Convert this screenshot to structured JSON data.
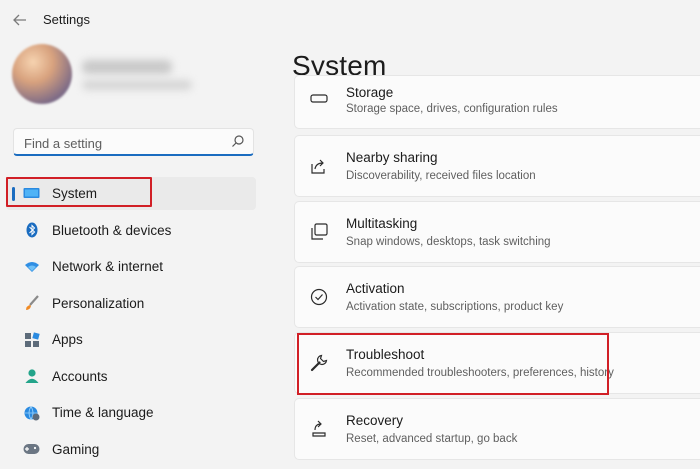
{
  "app": {
    "title": "Settings",
    "back_icon": "back-arrow-icon"
  },
  "search": {
    "placeholder": "Find a setting",
    "icon": "search-icon"
  },
  "sidebar": {
    "items": [
      {
        "label": "System",
        "icon": "monitor-icon",
        "selected": true
      },
      {
        "label": "Bluetooth & devices",
        "icon": "bluetooth-icon"
      },
      {
        "label": "Network & internet",
        "icon": "wifi-icon"
      },
      {
        "label": "Personalization",
        "icon": "brush-icon"
      },
      {
        "label": "Apps",
        "icon": "apps-icon"
      },
      {
        "label": "Accounts",
        "icon": "account-icon"
      },
      {
        "label": "Time & language",
        "icon": "globe-clock-icon"
      },
      {
        "label": "Gaming",
        "icon": "gamepad-icon"
      }
    ]
  },
  "main": {
    "title": "System",
    "cards": [
      {
        "title": "Storage",
        "desc": "Storage space, drives, configuration rules",
        "icon": "storage-icon"
      },
      {
        "title": "Nearby sharing",
        "desc": "Discoverability, received files location",
        "icon": "share-icon"
      },
      {
        "title": "Multitasking",
        "desc": "Snap windows, desktops, task switching",
        "icon": "multitasking-icon"
      },
      {
        "title": "Activation",
        "desc": "Activation state, subscriptions, product key",
        "icon": "check-circle-icon"
      },
      {
        "title": "Troubleshoot",
        "desc": "Recommended troubleshooters, preferences, history",
        "icon": "wrench-icon"
      },
      {
        "title": "Recovery",
        "desc": "Reset, advanced startup, go back",
        "icon": "recovery-icon"
      }
    ]
  },
  "colors": {
    "accent": "#1a6cc0",
    "highlight": "#d11f26",
    "background": "#f3f3f3"
  }
}
